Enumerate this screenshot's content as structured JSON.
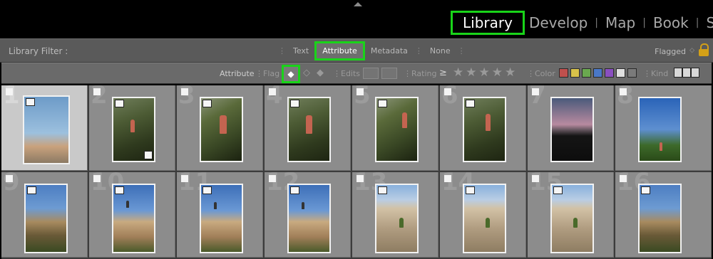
{
  "modules": {
    "items": [
      {
        "label": "Library",
        "active": true
      },
      {
        "label": "Develop",
        "active": false
      },
      {
        "label": "Map",
        "active": false
      },
      {
        "label": "Book",
        "active": false
      },
      {
        "label": "Sl",
        "active": false
      }
    ]
  },
  "filter_bar": {
    "title": "Library Filter :",
    "tabs": [
      "Text",
      "Attribute",
      "Metadata",
      "None"
    ],
    "active_tab": "Attribute",
    "preset": "Flagged"
  },
  "attribute_bar": {
    "label": "Attribute",
    "flag_label": "Flag",
    "edits_label": "Edits",
    "rating_label": "Rating",
    "rating_op": "≥",
    "stars": "★★★★★",
    "color_label": "Color",
    "kind_label": "Kind",
    "colors": [
      "#c0504d",
      "#d8c24a",
      "#6aa84f",
      "#4a78c8",
      "#8a4fc0",
      "#e0e0e0",
      "#7a7a7a"
    ]
  },
  "grid": {
    "cells": [
      {
        "num": "1",
        "selected": true,
        "scene": "sc-sky"
      },
      {
        "num": "2",
        "selected": false,
        "scene": "sc-green"
      },
      {
        "num": "3",
        "selected": false,
        "scene": "sc-green2"
      },
      {
        "num": "4",
        "selected": false,
        "scene": "sc-green"
      },
      {
        "num": "5",
        "selected": false,
        "scene": "sc-green2"
      },
      {
        "num": "6",
        "selected": false,
        "scene": "sc-green"
      },
      {
        "num": "7",
        "selected": false,
        "scene": "sc-dusk"
      },
      {
        "num": "8",
        "selected": false,
        "scene": "sc-palms"
      },
      {
        "num": "9",
        "selected": false,
        "scene": "sc-rock1"
      },
      {
        "num": "10",
        "selected": false,
        "scene": "sc-rock2"
      },
      {
        "num": "11",
        "selected": false,
        "scene": "sc-rock2"
      },
      {
        "num": "12",
        "selected": false,
        "scene": "sc-rock2"
      },
      {
        "num": "13",
        "selected": false,
        "scene": "sc-rock3"
      },
      {
        "num": "14",
        "selected": false,
        "scene": "sc-rock3"
      },
      {
        "num": "15",
        "selected": false,
        "scene": "sc-rock3"
      },
      {
        "num": "16",
        "selected": false,
        "scene": "sc-rock1"
      }
    ]
  }
}
